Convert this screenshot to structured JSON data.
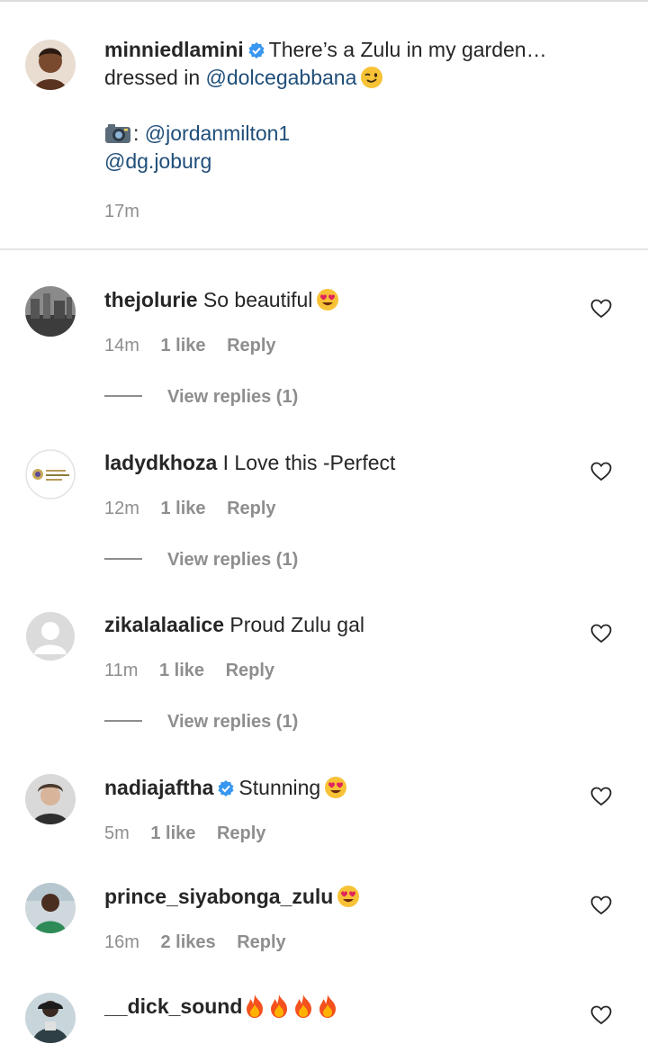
{
  "caption": {
    "username": "minniedlamini",
    "text_1": "There’s a Zulu in my garden…",
    "text_2": "dressed in",
    "mention_1": "@dolcegabbana",
    "camera_suffix": ":",
    "mention_2": "@jordanmilton1",
    "mention_3": "@dg.joburg",
    "time": "17m",
    "verified_icon": "verified-badge-icon",
    "emoji_icon": "winking-face-icon"
  },
  "comments": [
    {
      "username": "thejolurie",
      "text": "So beautiful",
      "emoji": "heart-eyes",
      "time": "14m",
      "likes": "1 like",
      "reply": "Reply",
      "view_replies": "View replies (1)"
    },
    {
      "username": "ladydkhoza",
      "text": "I Love this -Perfect",
      "time": "12m",
      "likes": "1 like",
      "reply": "Reply",
      "view_replies": "View replies (1)"
    },
    {
      "username": "zikalalaalice",
      "text": "Proud Zulu gal",
      "time": "11m",
      "likes": "1 like",
      "reply": "Reply",
      "view_replies": "View replies (1)"
    },
    {
      "username": "nadiajaftha",
      "verified": true,
      "text": "Stunning",
      "emoji": "heart-eyes",
      "time": "5m",
      "likes": "1 like",
      "reply": "Reply"
    },
    {
      "username": "prince_siyabonga_zulu",
      "text": "",
      "emoji": "heart-eyes",
      "time": "16m",
      "likes": "2 likes",
      "reply": "Reply"
    },
    {
      "username": "__dick_sound",
      "text": "",
      "emoji": "fire x4"
    }
  ],
  "colors": {
    "mention": "#1f4e79",
    "meta": "#8e8e8e",
    "verified": "#3897f0"
  }
}
